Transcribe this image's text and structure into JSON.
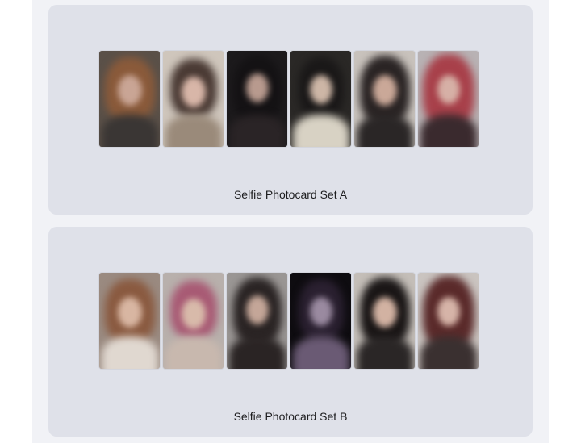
{
  "sets": [
    {
      "caption": "Selfie Photocard Set A",
      "photos": [
        {
          "bg": "#5a5048",
          "hair": "#8a5a3a",
          "skin": "#c9a595",
          "top": "#3a3634"
        },
        {
          "bg": "#cfc6bc",
          "hair": "#4a3a34",
          "skin": "#d8b6a8",
          "top": "#9a8a7a"
        },
        {
          "bg": "#1c1a1c",
          "hair": "#141214",
          "skin": "#b89a8e",
          "top": "#2a2426"
        },
        {
          "bg": "#2a2826",
          "hair": "#1a1818",
          "skin": "#cdb6a6",
          "top": "#d8d2c4"
        },
        {
          "bg": "#c8c2bc",
          "hair": "#2a2424",
          "skin": "#caa898",
          "top": "#2a2626"
        },
        {
          "bg": "#b8b2b4",
          "hair": "#a8404a",
          "skin": "#d6b0a6",
          "top": "#3a2a2e"
        }
      ]
    },
    {
      "caption": "Selfie Photocard Set B",
      "photos": [
        {
          "bg": "#9a8a80",
          "hair": "#8a5a40",
          "skin": "#d8b6a2",
          "top": "#e0d8d0"
        },
        {
          "bg": "#b8b0ac",
          "hair": "#a85a74",
          "skin": "#d8baaa",
          "top": "#c8b8ae"
        },
        {
          "bg": "#9a9694",
          "hair": "#2a2424",
          "skin": "#c4a698",
          "top": "#2a2424"
        },
        {
          "bg": "#0e0c10",
          "hair": "#2a2030",
          "skin": "#9a8aa0",
          "top": "#6a5a74"
        },
        {
          "bg": "#c4beb8",
          "hair": "#1a1616",
          "skin": "#d2b2a2",
          "top": "#2a2626"
        },
        {
          "bg": "#cac4c0",
          "hair": "#5a2a2a",
          "skin": "#d6b4a8",
          "top": "#3a3030"
        }
      ]
    }
  ]
}
